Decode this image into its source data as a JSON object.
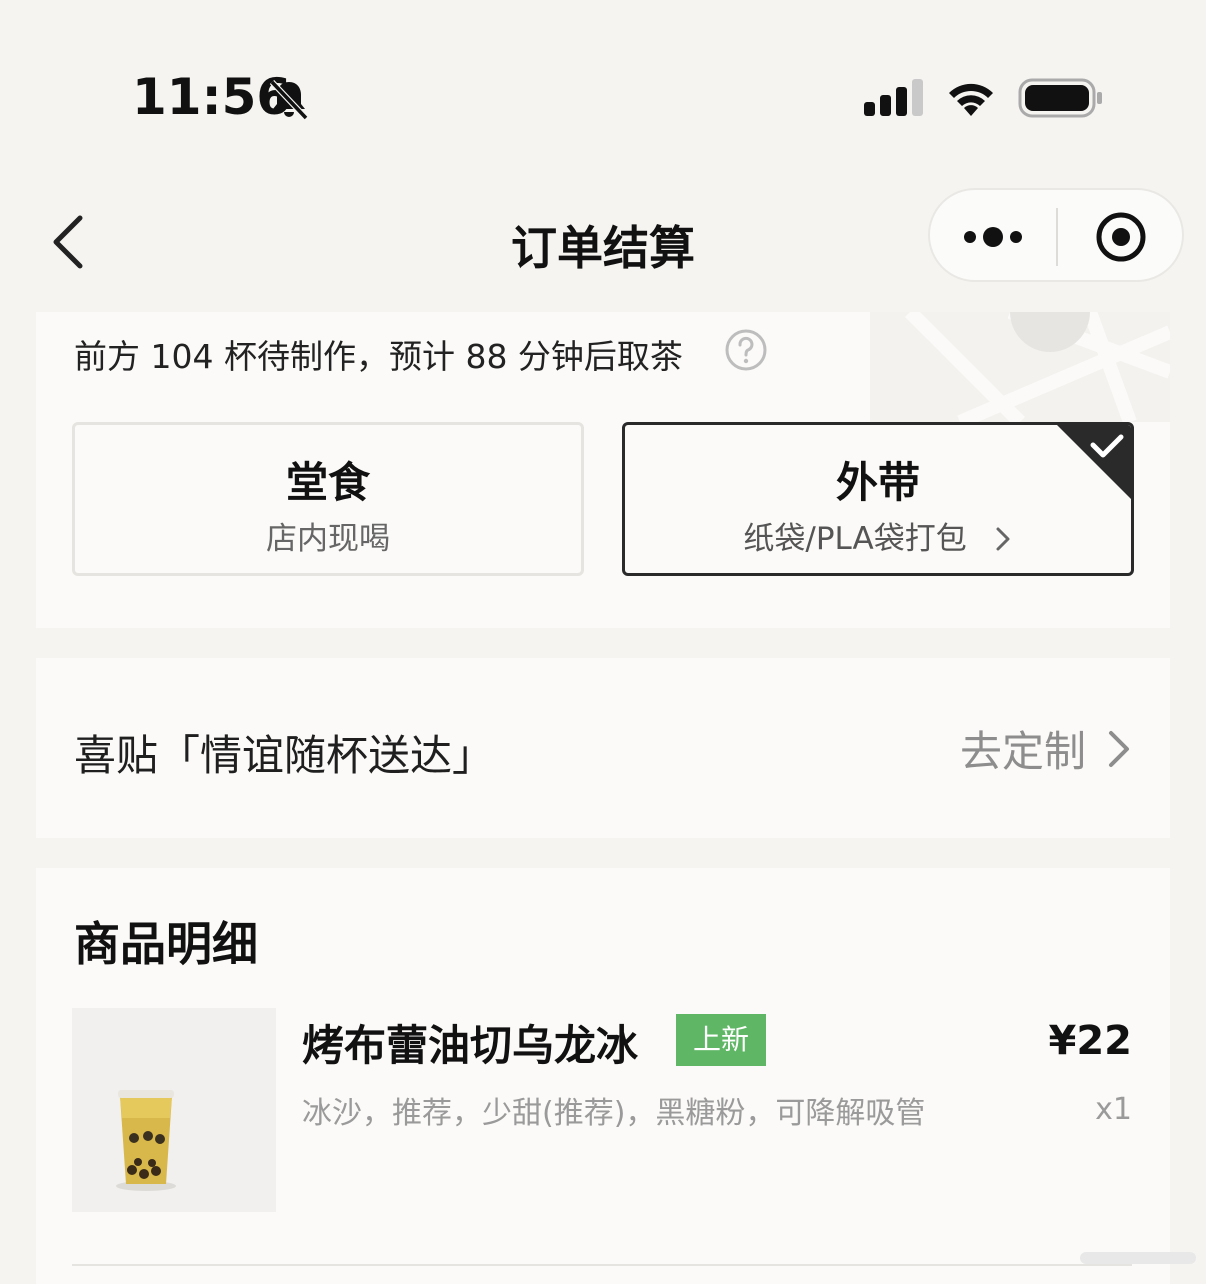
{
  "status_bar": {
    "time": "11:56",
    "icons": [
      "bell-muted-icon",
      "signal-icon",
      "wifi-icon",
      "battery-icon"
    ]
  },
  "nav": {
    "title": "订单结算",
    "back_icon": "chevron-left-icon",
    "capsule_icons": [
      "more-dots-icon",
      "target-icon"
    ]
  },
  "queue": {
    "text": "前方 104 杯待制作，预计 88 分钟后取茶",
    "help_icon": "question-circle-icon"
  },
  "dining_options": [
    {
      "title": "堂食",
      "subtitle": "店内现喝",
      "selected": false
    },
    {
      "title": "外带",
      "subtitle": "纸袋/PLA袋打包",
      "selected": true
    }
  ],
  "sticker": {
    "label": "喜贴「情谊随杯送达」",
    "action": "去定制"
  },
  "products": {
    "section_title": "商品明细",
    "items": [
      {
        "name": "烤布蕾油切乌龙冰",
        "badge": "上新",
        "price": "¥22",
        "quantity": "x1",
        "spec": "冰沙，推荐，少甜(推荐)，黑糖粉，可降解吸管"
      }
    ]
  },
  "colors": {
    "background": "#f5f4f1",
    "card": "#fbfaf8",
    "badge_green": "#5fb766",
    "selected_border": "#2a2a2a"
  }
}
